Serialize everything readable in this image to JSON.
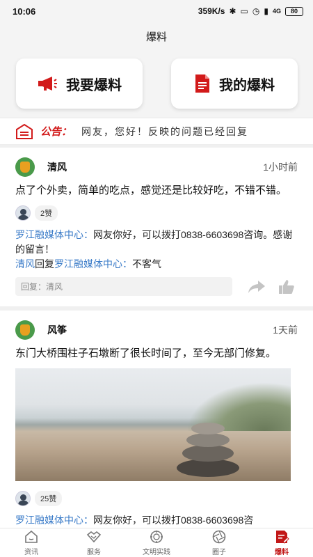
{
  "status_bar": {
    "time": "10:06",
    "speed": "359K/s",
    "network": "4G",
    "battery": "80"
  },
  "header": {
    "title": "爆料"
  },
  "actions": [
    {
      "label": "我要爆料",
      "icon": "megaphone-icon"
    },
    {
      "label": "我的爆料",
      "icon": "document-icon"
    }
  ],
  "notice": {
    "label": "公告：",
    "text": "网友，您好！反映的问题已经回复"
  },
  "posts": [
    {
      "author": "清风",
      "time": "1小时前",
      "body": "点了个外卖，简单的吃点，感觉还是比较好吃，不错不错。",
      "likes": "2赞",
      "comments": [
        {
          "user": "罗江融媒体中心",
          "sep": "：",
          "text": "网友你好，可以拨打0838-6603698咨询。感谢的留言！"
        },
        {
          "user": "清风",
          "mid": "回复",
          "target": "罗江融媒体中心",
          "sep": "：",
          "text": "不客气"
        }
      ],
      "reply_placeholder": "回复：清风"
    },
    {
      "author": "风筝",
      "time": "1天前",
      "body": "东门大桥围柱子石墩断了很长时间了，至今无部门修复。",
      "likes": "25赞",
      "comments": [
        {
          "user": "罗江融媒体中心",
          "sep": "：",
          "text": "网友你好，可以拨打0838-6603698咨"
        }
      ]
    }
  ],
  "tabs": [
    {
      "label": "资讯",
      "icon": "home-icon",
      "active": false
    },
    {
      "label": "服务",
      "icon": "handshake-icon",
      "active": false
    },
    {
      "label": "文明实践",
      "icon": "badge-icon",
      "active": false
    },
    {
      "label": "圈子",
      "icon": "aperture-icon",
      "active": false
    },
    {
      "label": "爆料",
      "icon": "edit-doc-icon",
      "active": true
    }
  ],
  "colors": {
    "accent": "#d21a1a",
    "link": "#3a7bc8"
  }
}
